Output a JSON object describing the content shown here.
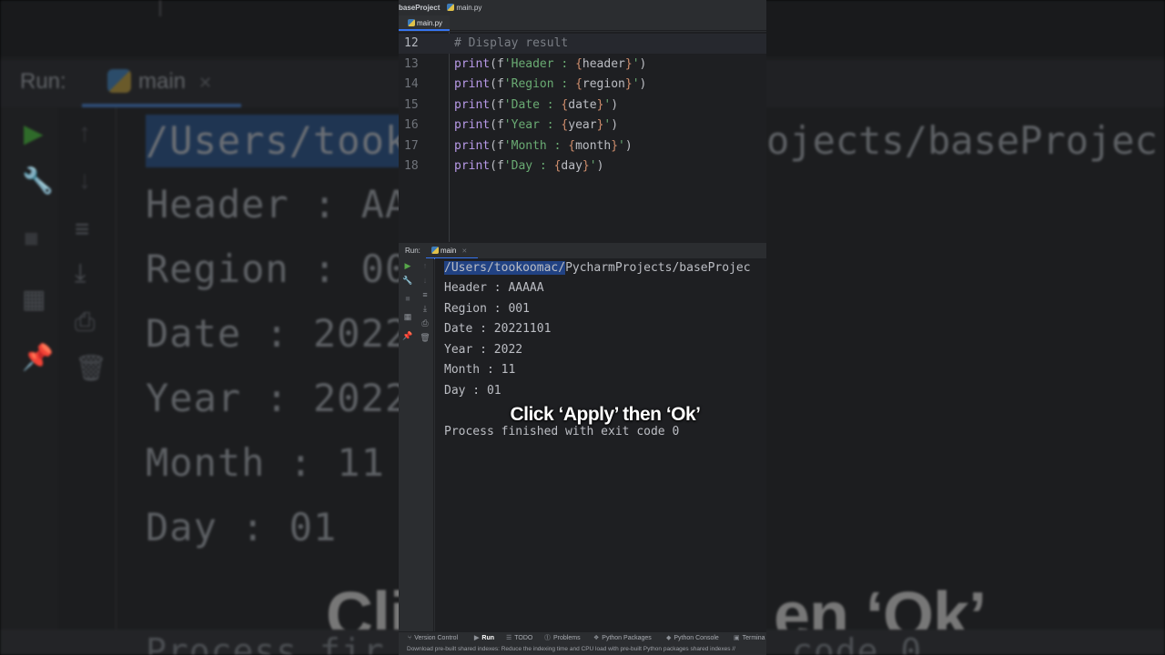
{
  "breadcrumb": {
    "project": "baseProject",
    "file": "main.py"
  },
  "editor": {
    "tab_label": "main.py",
    "lines": [
      {
        "num": "12",
        "segments": [
          {
            "t": "# Display result",
            "c": "cmt"
          }
        ]
      },
      {
        "num": "13",
        "segments": [
          {
            "t": "print",
            "c": "kw"
          },
          {
            "t": "(f",
            "c": "var"
          },
          {
            "t": "'Header : ",
            "c": "str"
          },
          {
            "t": "{",
            "c": "brace"
          },
          {
            "t": "header",
            "c": "var"
          },
          {
            "t": "}",
            "c": "brace"
          },
          {
            "t": "'",
            "c": "str"
          },
          {
            "t": ")",
            "c": "var"
          }
        ]
      },
      {
        "num": "14",
        "segments": [
          {
            "t": "print",
            "c": "kw"
          },
          {
            "t": "(f",
            "c": "var"
          },
          {
            "t": "'Region : ",
            "c": "str"
          },
          {
            "t": "{",
            "c": "brace"
          },
          {
            "t": "region",
            "c": "var"
          },
          {
            "t": "}",
            "c": "brace"
          },
          {
            "t": "'",
            "c": "str"
          },
          {
            "t": ")",
            "c": "var"
          }
        ]
      },
      {
        "num": "15",
        "segments": [
          {
            "t": "print",
            "c": "kw"
          },
          {
            "t": "(f",
            "c": "var"
          },
          {
            "t": "'Date : ",
            "c": "str"
          },
          {
            "t": "{",
            "c": "brace"
          },
          {
            "t": "date",
            "c": "var"
          },
          {
            "t": "}",
            "c": "brace"
          },
          {
            "t": "'",
            "c": "str"
          },
          {
            "t": ")",
            "c": "var"
          }
        ]
      },
      {
        "num": "16",
        "segments": [
          {
            "t": "print",
            "c": "kw"
          },
          {
            "t": "(f",
            "c": "var"
          },
          {
            "t": "'Year : ",
            "c": "str"
          },
          {
            "t": "{",
            "c": "brace"
          },
          {
            "t": "year",
            "c": "var"
          },
          {
            "t": "}",
            "c": "brace"
          },
          {
            "t": "'",
            "c": "str"
          },
          {
            "t": ")",
            "c": "var"
          }
        ]
      },
      {
        "num": "17",
        "segments": [
          {
            "t": "print",
            "c": "kw"
          },
          {
            "t": "(f",
            "c": "var"
          },
          {
            "t": "'Month : ",
            "c": "str"
          },
          {
            "t": "{",
            "c": "brace"
          },
          {
            "t": "month",
            "c": "var"
          },
          {
            "t": "}",
            "c": "brace"
          },
          {
            "t": "'",
            "c": "str"
          },
          {
            "t": ")",
            "c": "var"
          }
        ]
      },
      {
        "num": "18",
        "segments": [
          {
            "t": "print",
            "c": "kw"
          },
          {
            "t": "(f",
            "c": "var"
          },
          {
            "t": "'Day : ",
            "c": "str"
          },
          {
            "t": "{",
            "c": "brace"
          },
          {
            "t": "day",
            "c": "var"
          },
          {
            "t": "}",
            "c": "brace"
          },
          {
            "t": "'",
            "c": "str"
          },
          {
            "t": ")",
            "c": "var"
          }
        ]
      }
    ]
  },
  "run": {
    "label": "Run:",
    "tab": "main",
    "path_highlight": "/Users/tookoomac/",
    "path_rest": "PycharmProjects/baseProjec",
    "output": [
      "Header : AAAAA",
      "Region : 001",
      "Date : 20221101",
      "Year : 2022",
      "Month : 11",
      "Day : 01"
    ],
    "finished": "Process finished with exit code 0",
    "tools_left": [
      {
        "icon": "run-icon",
        "glyph": "▶"
      },
      {
        "icon": "wrench-icon",
        "glyph": "🔧"
      },
      {
        "icon": "stop-icon",
        "glyph": "■"
      },
      {
        "icon": "layout-icon",
        "glyph": "▦"
      },
      {
        "icon": "pin-icon",
        "glyph": "📌"
      }
    ],
    "tools_right": [
      {
        "icon": "arrow-up-icon",
        "glyph": "↑"
      },
      {
        "icon": "arrow-down-icon",
        "glyph": "↓"
      },
      {
        "icon": "soft-wrap-icon",
        "glyph": "≡"
      },
      {
        "icon": "scroll-end-icon",
        "glyph": "⤓"
      },
      {
        "icon": "print-icon",
        "glyph": "⎙"
      },
      {
        "icon": "trash-icon",
        "glyph": "🗑"
      }
    ]
  },
  "caption": "Click ‘Apply’ then ‘Ok’",
  "background": {
    "run_label": "Run:",
    "tab": "main",
    "path_left": "/Users/took",
    "path_right": "ojects/baseProjec",
    "lines": [
      "Header : AA",
      "Region : 00",
      "Date : 2022",
      "Year : 2022",
      "Month : 11",
      "Day : 01"
    ],
    "caption_left": "Cli",
    "caption_right": "en ‘Ok’",
    "process_left": "Process fir",
    "process_right": "code 0"
  },
  "bottom_tabs": [
    {
      "name": "version-control",
      "icon": "branch-icon",
      "glyph": "⑂",
      "label": "Version Control"
    },
    {
      "name": "run",
      "icon": "run-icon",
      "glyph": "▶",
      "label": "Run",
      "active": true
    },
    {
      "name": "todo",
      "icon": "list-icon",
      "glyph": "☰",
      "label": "TODO"
    },
    {
      "name": "problems",
      "icon": "warning-icon",
      "glyph": "⓵",
      "label": "Problems"
    },
    {
      "name": "python-packages",
      "icon": "package-icon",
      "glyph": "❖",
      "label": "Python Packages"
    },
    {
      "name": "python-console",
      "icon": "console-icon",
      "glyph": "◆",
      "label": "Python Console"
    },
    {
      "name": "terminal",
      "icon": "terminal-icon",
      "glyph": "▣",
      "label": "Termina"
    }
  ],
  "status_message": "Download pre-built shared indexes: Reduce the indexing time and CPU load with pre-built Python packages shared indexes //"
}
